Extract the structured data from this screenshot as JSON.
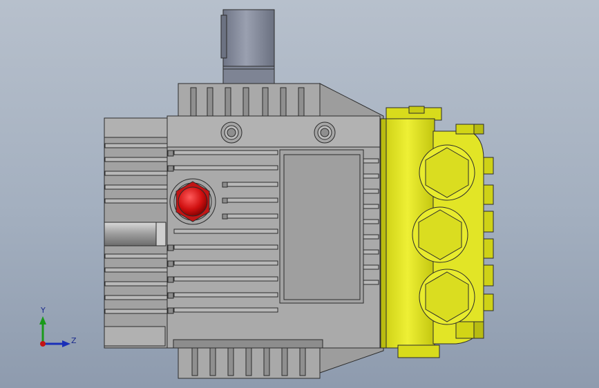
{
  "viewport": {
    "background_top": "#b7c0cc",
    "background_bottom": "#8e9bae"
  },
  "model": {
    "body_color": "#a8a8a8",
    "manifold_color": "#e3e623",
    "shaft_color": "#7d8392",
    "oil_cap_color": "#d01414"
  },
  "triad": {
    "y_label": "Y",
    "z_label": "Z",
    "y_color": "#1a9a1a",
    "z_color": "#1a2fb8",
    "x_color": "#c41414"
  }
}
